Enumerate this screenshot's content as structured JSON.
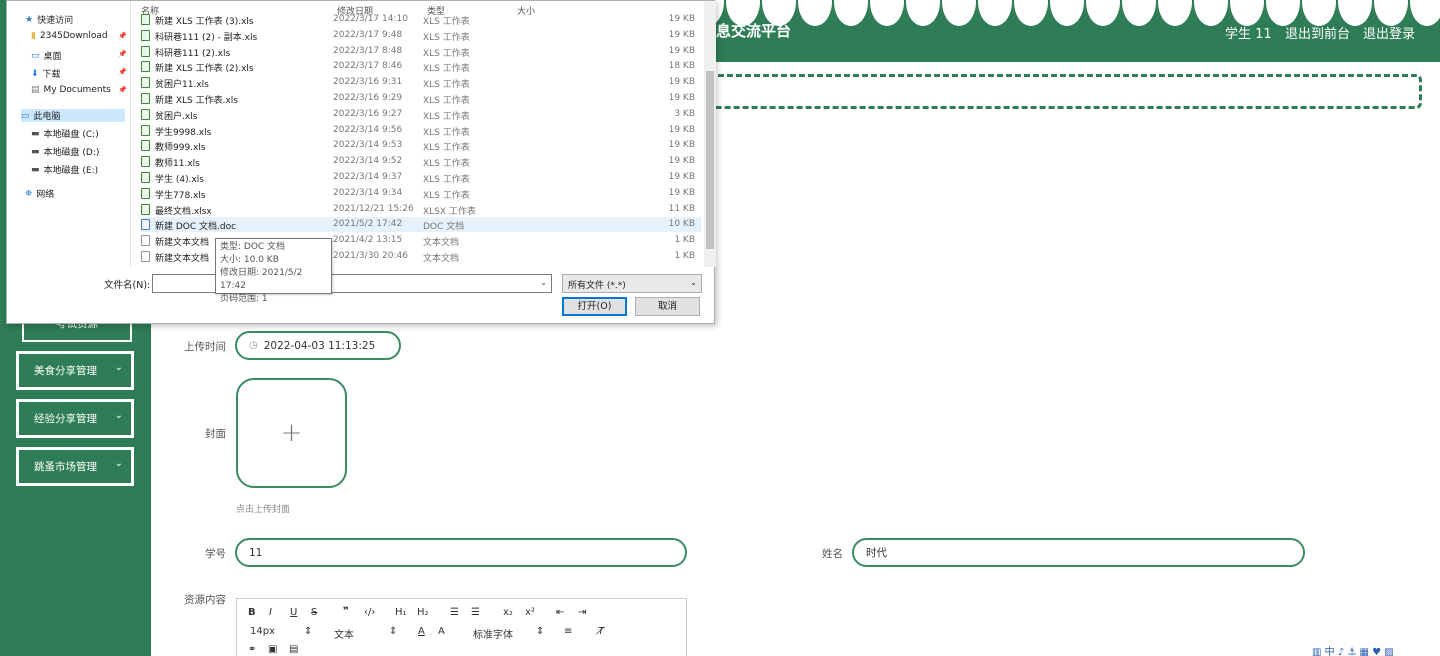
{
  "header": {
    "brand_partial": "息交流平台",
    "user": "学生 11",
    "back_front": "退出到前台",
    "logout": "退出登录"
  },
  "sidebar": {
    "top_item_partial": "考试资源",
    "items": [
      {
        "label": "美食分享管理"
      },
      {
        "label": "经验分享管理"
      },
      {
        "label": "跳蚤市场管理"
      }
    ]
  },
  "form": {
    "upload_time_label": "上传时间",
    "upload_time_value": "2022-04-03 11:13:25",
    "cover_label": "封面",
    "cover_hint": "点击上传封面",
    "student_no_label": "学号",
    "student_no_value": "11",
    "name_label": "姓名",
    "name_value": "时代",
    "content_label": "资源内容"
  },
  "editor": {
    "font_size": "14px",
    "text_type": "文本",
    "font_family": "标准字体"
  },
  "dialog": {
    "nav": [
      {
        "label": "快速访问",
        "icon": "star-icon"
      },
      {
        "label": "2345Download",
        "icon": "folder-icon",
        "pinned": true
      },
      {
        "label": "桌面",
        "icon": "desktop-icon",
        "pinned": true
      },
      {
        "label": "下载",
        "icon": "download-icon",
        "pinned": true
      },
      {
        "label": "My Documents",
        "icon": "documents-icon",
        "pinned": true
      },
      {
        "label": "此电脑",
        "icon": "computer-icon"
      },
      {
        "label": "本地磁盘 (C:)",
        "icon": "drive-icon"
      },
      {
        "label": "本地磁盘 (D:)",
        "icon": "drive-icon"
      },
      {
        "label": "本地磁盘 (E:)",
        "icon": "drive-icon"
      },
      {
        "label": "网络",
        "icon": "network-icon"
      }
    ],
    "columns": {
      "name": "名称",
      "date": "修改日期",
      "type": "类型",
      "size": "大小"
    },
    "files": [
      {
        "name": "新建 XLS 工作表 (3).xls",
        "date": "2022/3/17 14:10",
        "type": "XLS 工作表",
        "size": "19 KB"
      },
      {
        "name": "科研巷111 (2) - 副本.xls",
        "date": "2022/3/17 9:48",
        "type": "XLS 工作表",
        "size": "19 KB"
      },
      {
        "name": "科研巷111 (2).xls",
        "date": "2022/3/17 8:48",
        "type": "XLS 工作表",
        "size": "19 KB"
      },
      {
        "name": "新建 XLS 工作表 (2).xls",
        "date": "2022/3/17 8:46",
        "type": "XLS 工作表",
        "size": "18 KB"
      },
      {
        "name": "贫困户11.xls",
        "date": "2022/3/16 9:31",
        "type": "XLS 工作表",
        "size": "19 KB"
      },
      {
        "name": "新建 XLS 工作表.xls",
        "date": "2022/3/16 9:29",
        "type": "XLS 工作表",
        "size": "19 KB"
      },
      {
        "name": "贫困户.xls",
        "date": "2022/3/16 9:27",
        "type": "XLS 工作表",
        "size": "3 KB"
      },
      {
        "name": "学生9998.xls",
        "date": "2022/3/14 9:56",
        "type": "XLS 工作表",
        "size": "19 KB"
      },
      {
        "name": "教师999.xls",
        "date": "2022/3/14 9:53",
        "type": "XLS 工作表",
        "size": "19 KB"
      },
      {
        "name": "教师11.xls",
        "date": "2022/3/14 9:52",
        "type": "XLS 工作表",
        "size": "19 KB"
      },
      {
        "name": "学生 (4).xls",
        "date": "2022/3/14 9:37",
        "type": "XLS 工作表",
        "size": "19 KB"
      },
      {
        "name": "学生778.xls",
        "date": "2022/3/14 9:34",
        "type": "XLS 工作表",
        "size": "19 KB"
      },
      {
        "name": "最终文档.xlsx",
        "date": "2021/12/21 15:26",
        "type": "XLSX 工作表",
        "size": "11 KB"
      },
      {
        "name": "新建 DOC 文档.doc",
        "date": "2021/5/2 17:42",
        "type": "DOC 文档",
        "size": "10 KB"
      },
      {
        "name": "新建文本文档",
        "date": "2021/4/2 13:15",
        "type": "文本文档",
        "size": "1 KB"
      },
      {
        "name": "新建文本文档",
        "date": "2021/3/30 20:46",
        "type": "文本文档",
        "size": "1 KB"
      }
    ],
    "tooltip": {
      "type": "类型: DOC 文档",
      "size": "大小: 10.0 KB",
      "date": "修改日期: 2021/5/2 17:42",
      "pages": "页码范围: 1"
    },
    "filename_label": "文件名(N):",
    "filter": "所有文件 (*.*)",
    "open_button": "打开(O)",
    "cancel_button": "取消"
  },
  "colors": {
    "accent": "#2e7d57",
    "selection": "#e5f1fb"
  }
}
